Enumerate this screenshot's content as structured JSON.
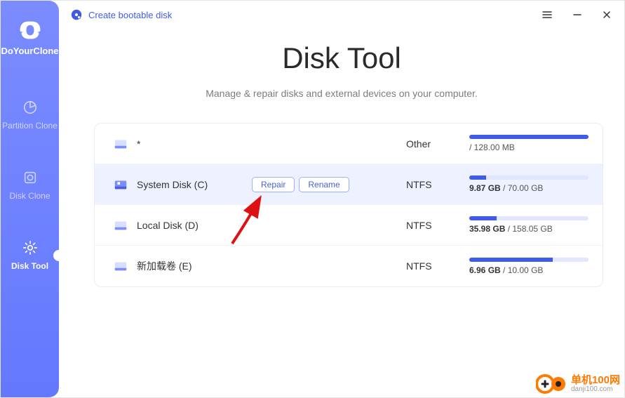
{
  "brand": {
    "name": "DoYourClone"
  },
  "topbar": {
    "create_bootable": "Create bootable disk"
  },
  "nav": {
    "items": [
      {
        "label": "Partition Clone"
      },
      {
        "label": "Disk Clone"
      },
      {
        "label": "Disk Tool"
      }
    ]
  },
  "page": {
    "title": "Disk Tool",
    "subtitle": "Manage & repair disks and external devices on your computer."
  },
  "actions": {
    "repair": "Repair",
    "rename": "Rename"
  },
  "disks": [
    {
      "name": "*",
      "fs": "Other",
      "used": "",
      "total": "/ 128.00 MB",
      "pct": 100,
      "selected": false
    },
    {
      "name": "System Disk (C)",
      "fs": "NTFS",
      "used": "9.87 GB",
      "total": " / 70.00 GB",
      "pct": 14,
      "selected": true
    },
    {
      "name": "Local Disk (D)",
      "fs": "NTFS",
      "used": "35.98 GB",
      "total": " / 158.05 GB",
      "pct": 23,
      "selected": false
    },
    {
      "name": "新加载卷 (E)",
      "fs": "NTFS",
      "used": "6.96 GB",
      "total": " / 10.00 GB",
      "pct": 70,
      "selected": false
    }
  ],
  "colors": {
    "accent": "#3f5be8",
    "sidebar": "#6b7fff"
  },
  "watermark": {
    "line1": "单机100网",
    "line2": "danji100.com"
  }
}
